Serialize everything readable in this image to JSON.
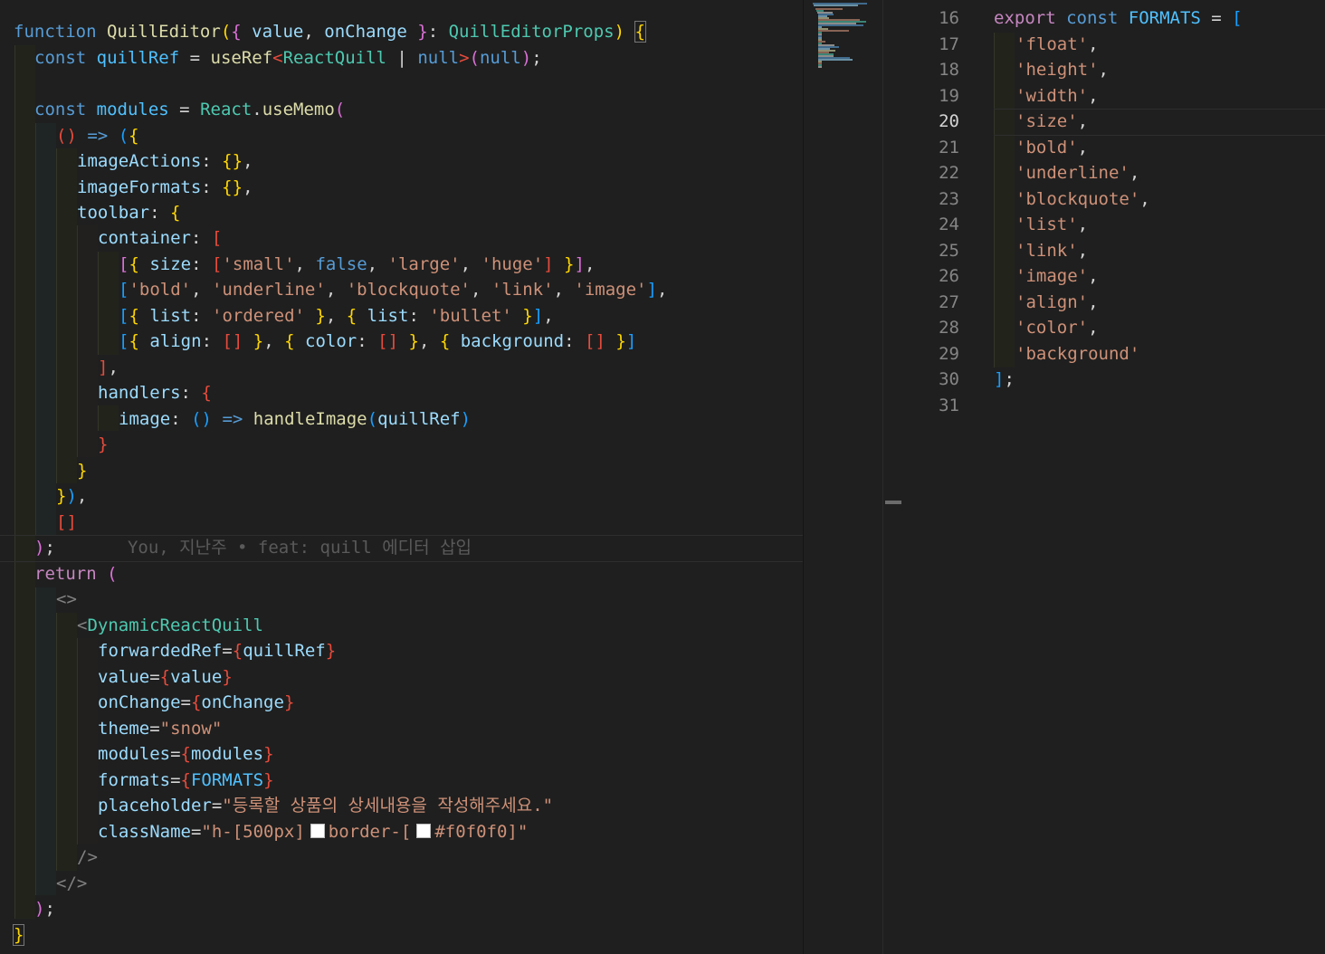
{
  "left_editor": {
    "lines": [
      "function QuillEditor({ value, onChange }: QuillEditorProps) {",
      "const quillRef = useRef<ReactQuill | null>(null);",
      "",
      "const modules = React.useMemo(",
      "() => ({",
      "imageActions: {},",
      "imageFormats: {},",
      "toolbar: {",
      "container: [",
      "[{ size: ['small', false, 'large', 'huge'] }],",
      "['bold', 'underline', 'blockquote', 'link', 'image'],",
      "[{ list: 'ordered' }, { list: 'bullet' }],",
      "[{ align: [] }, { color: [] }, { background: [] }]",
      "],",
      "handlers: {",
      "image: () => handleImage(quillRef)",
      "}",
      "}",
      "}),",
      "[]",
      ");",
      "return (",
      "<>",
      "<DynamicReactQuill",
      "forwardedRef={quillRef}",
      "value={value}",
      "onChange={onChange}",
      "theme=\"snow\"",
      "modules={modules}",
      "formats={FORMATS}",
      "placeholder=\"등록할 상품의 상세내용을 작성해주세요.\"",
      "className=\"h-[500px] border-[#f0f0f0]\"",
      "/>",
      "</>",
      ");",
      "}"
    ],
    "blame_text": "You, 지난주 • feat: quill 에디터 삽입"
  },
  "right_editor": {
    "line_numbers": [
      "16",
      "17",
      "18",
      "19",
      "20",
      "21",
      "22",
      "23",
      "24",
      "25",
      "26",
      "27",
      "28",
      "29",
      "30",
      "31"
    ],
    "active_line": "20",
    "lines": [
      "export const FORMATS = [",
      "'float',",
      "'height',",
      "'width',",
      "'size',",
      "'bold',",
      "'underline',",
      "'blockquote',",
      "'list',",
      "'link',",
      "'image',",
      "'align',",
      "'color',",
      "'background'",
      "];",
      ""
    ]
  },
  "colors": {
    "background": "#1f1f1f",
    "keyword": "#569cd6",
    "string": "#ce9178",
    "function": "#dcdcaa",
    "type": "#4ec9b0",
    "variable": "#9cdcfe"
  }
}
